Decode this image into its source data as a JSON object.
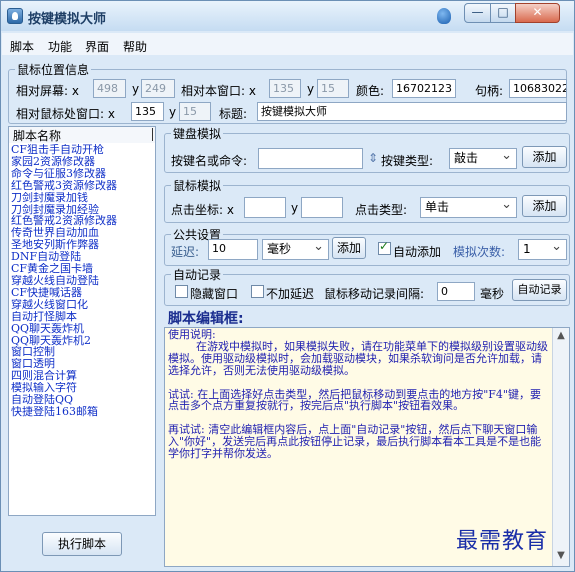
{
  "window": {
    "title": "按键模拟大师"
  },
  "window_controls": {
    "minimize": "—",
    "maximize": "□",
    "close": "✕"
  },
  "menu": [
    "脚本",
    "功能",
    "界面",
    "帮助"
  ],
  "mouse_info": {
    "legend": "鼠标位置信息",
    "screen_label": "相对屏幕: x",
    "screen_x": "498",
    "y_label": "y",
    "screen_y": "249",
    "window_label": "相对本窗口: x",
    "window_x": "135",
    "window_y": "15",
    "color_label": "颜色:",
    "color_value": "16702123",
    "handle_label": "句柄:",
    "handle_value": "10683022",
    "mouse_window_label": "相对鼠标处窗口: x",
    "mouse_window_x": "135",
    "mouse_window_y": "15",
    "title_label": "标题:",
    "title_value": "按键模拟大师"
  },
  "script_list": {
    "header": "脚本名称",
    "items": [
      "CF狙击手自动开枪",
      "家园2资源修改器",
      "命令与征服3修改器",
      "红色警戒3资源修改器",
      "刀剑封魔录加钱",
      "刀剑封魔录加经验",
      "红色警戒2资源修改器",
      "传奇世界自动加血",
      "圣地安列斯作弊器",
      "DNF自动登陆",
      "CF黄金之国卡墙",
      "穿越火线自动登陆",
      "CF快捷喊话器",
      "穿越火线窗口化",
      "自动打怪脚本",
      "QQ聊天轰炸机",
      "QQ聊天轰炸机2",
      "窗口控制",
      "窗口透明",
      "四则混合计算",
      "模拟输入字符",
      "自动登陆QQ",
      "快捷登陆163邮箱"
    ],
    "run_button": "执行脚本"
  },
  "keyboard": {
    "legend": "键盘模拟",
    "key_label": "按键名或命令:",
    "key_value": "",
    "type_label": "按键类型:",
    "type_value": "敲击",
    "add_button": "添加"
  },
  "mouse_sim": {
    "legend": "鼠标模拟",
    "coord_label": "点击坐标: x",
    "y_label": "y",
    "x_value": "",
    "y_value": "",
    "type_label": "点击类型:",
    "type_value": "单击",
    "add_button": "添加"
  },
  "common": {
    "legend": "公共设置",
    "delay_label": "延迟:",
    "delay_value": "10",
    "unit_value": "毫秒",
    "add_button": "添加",
    "auto_add_label": "自动添加",
    "repeat_label": "模拟次数:",
    "repeat_value": "1"
  },
  "record": {
    "legend": "自动记录",
    "hide_label": "隐藏窗口",
    "no_delay_label": "不加延迟",
    "interval_label": "鼠标移动记录间隔:",
    "interval_value": "0",
    "unit": "毫秒",
    "record_button": "自动记录"
  },
  "editor": {
    "title": "脚本编辑框:",
    "text": "使用说明:\n        在游戏中模拟时，如果模拟失败，请在功能菜单下的模拟级别设置驱动级模拟。使用驱动级模拟时，会加载驱动模块，如果杀软询问是否允许加载，请选择允许，否则无法使用驱动级模拟。\n\n试试: 在上面选择好点击类型，然后把鼠标移动到要点击的地方按\"F4\"键，要点击多个点方重复按就行，按完后点\"执行脚本\"按钮看效果。\n\n再试试: 清空此编辑框内容后，点上面\"自动记录\"按钮，然后点下聊天窗口输入\"你好\"，发送完后再点此按钮停止记录，最后执行脚本看本工具是不是也能学你打字并帮你发送。"
  },
  "watermark": "最需教育"
}
